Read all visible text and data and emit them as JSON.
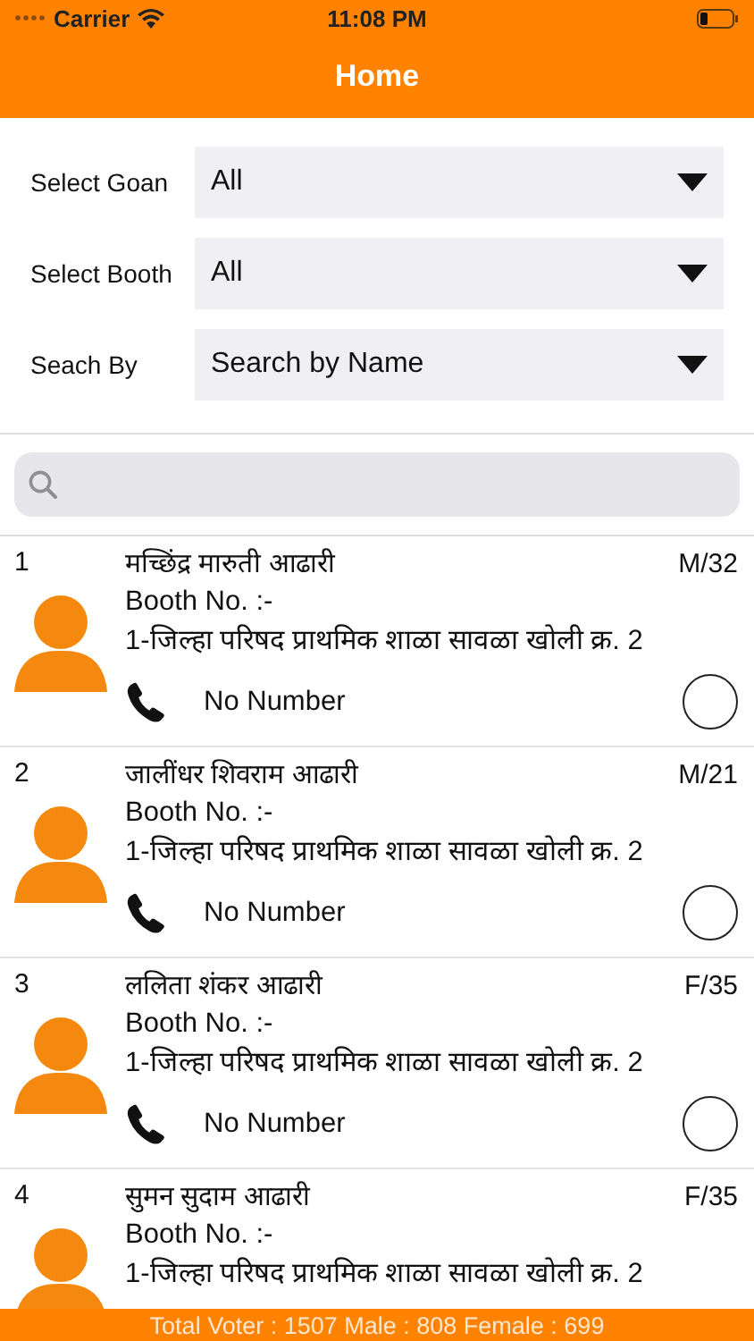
{
  "status_bar": {
    "carrier": "Carrier",
    "time": "11:08 PM"
  },
  "nav": {
    "title": "Home"
  },
  "filters": [
    {
      "label": "Select Goan",
      "value": "All"
    },
    {
      "label": "Select Booth",
      "value": "All"
    },
    {
      "label": "Seach By",
      "value": "Search by Name"
    }
  ],
  "voters": [
    {
      "number": "1",
      "name": "मच्छिंद्र मारुती आढारी",
      "gender_age": "M/32",
      "booth": "Booth No. :-",
      "address": "1-जिल्हा परिषद प्राथमिक शाळा सावळा  खोली क्र. 2",
      "phone": "No Number",
      "selected": false
    },
    {
      "number": "2",
      "name": "जालींधर शिवराम आढारी",
      "gender_age": "M/21",
      "booth": "Booth No. :-",
      "address": "1-जिल्हा परिषद प्राथमिक शाळा सावळा  खोली क्र. 2",
      "phone": "No Number",
      "selected": false
    },
    {
      "number": "3",
      "name": "ललिता शंकर आढारी",
      "gender_age": "F/35",
      "booth": "Booth No. :-",
      "address": "1-जिल्हा परिषद प्राथमिक शाळा सावळा  खोली क्र. 2",
      "phone": "No Number",
      "selected": false
    },
    {
      "number": "4",
      "name": "सुमन सुदाम आढारी",
      "gender_age": "F/35",
      "booth": "Booth No. :-",
      "address": "1-जिल्हा परिषद प्राथमिक शाळा सावळा  खोली क्र. 2"
    }
  ],
  "footer": {
    "summary": "Total Voter : 1507 Male : 808 Female : 699"
  }
}
